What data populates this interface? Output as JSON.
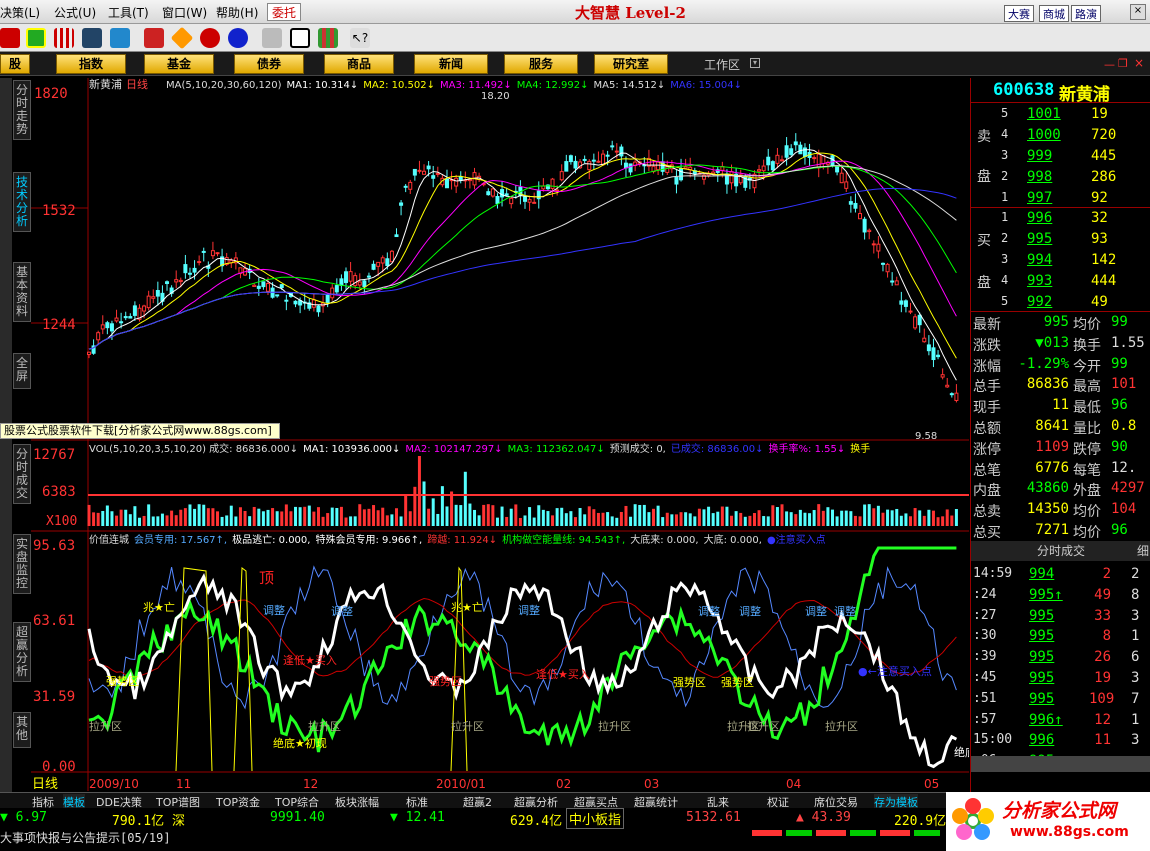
{
  "menubar": {
    "items": [
      "决策(L)",
      "公式(U)",
      "工具(T)",
      "窗口(W)",
      "帮助(H)"
    ],
    "commission": "委托",
    "logo": "大智慧 Level-2",
    "right_buttons": [
      "大赛",
      "商城",
      "路演"
    ]
  },
  "categories": [
    "股",
    "指数",
    "基金",
    "债券",
    "商品",
    "新闻",
    "服务",
    "研究室"
  ],
  "workzone": "工作区",
  "sidetabs": [
    "分时走势",
    "技术分析",
    "基本资料",
    "全屏",
    "分时成交",
    "实盘监控",
    "超赢分析",
    "其他"
  ],
  "main": {
    "title": "新黄浦",
    "period": "日线",
    "ma_legend": [
      {
        "t": "MA(5,10,20,30,60,120)",
        "c": "#ddd"
      },
      {
        "t": "MA1: 10.314↓",
        "c": "#fff"
      },
      {
        "t": "MA2: 10.502↓",
        "c": "#ff0"
      },
      {
        "t": "MA3: 11.492↓",
        "c": "#f0f"
      },
      {
        "t": "MA4: 12.992↓",
        "c": "#0f0"
      },
      {
        "t": "MA5: 14.512↓",
        "c": "#ddd"
      },
      {
        "t": "MA6: 15.004↓",
        "c": "#33f"
      }
    ],
    "y_labels": [
      "1820",
      "1532",
      "1244"
    ],
    "high_label": "18.20",
    "low_label": "9.58"
  },
  "volume": {
    "y_labels": [
      "12767",
      "6383",
      "X100"
    ],
    "legend": [
      {
        "t": "VOL(5,10,20,3,5,10,20) 成交: 86836.000↓",
        "c": "#ddd"
      },
      {
        "t": "MA1: 103936.000↓",
        "c": "#fff"
      },
      {
        "t": "MA2: 102147.297↓",
        "c": "#f0f"
      },
      {
        "t": "MA3: 112362.047↓",
        "c": "#0f0"
      },
      {
        "t": "预测成交: 0,",
        "c": "#ddd"
      },
      {
        "t": "已成交: 86836.00↓",
        "c": "#33f"
      },
      {
        "t": "换手率%: 1.55↓",
        "c": "#f0f"
      },
      {
        "t": "换手",
        "c": "#ff0"
      }
    ]
  },
  "indicator": {
    "y_labels": [
      "95.63",
      "63.61",
      "31.59",
      "0.00"
    ],
    "legend": [
      {
        "t": "价值连城",
        "c": "#ddd"
      },
      {
        "t": "会员专用: 17.567↑,",
        "c": "#5af"
      },
      {
        "t": "极品逃亡: 0.000,",
        "c": "#fff"
      },
      {
        "t": "特殊会员专用: 9.966↑,",
        "c": "#fff"
      },
      {
        "t": "蹄越: 11.924↓",
        "c": "#f33"
      },
      {
        "t": "机构做空能量线: 94.543↑,",
        "c": "#0f0"
      },
      {
        "t": "大底来: 0.000,",
        "c": "#ddd"
      },
      {
        "t": "大底: 0.000,",
        "c": "#ddd"
      },
      {
        "t": "●注意买入点",
        "c": "#33f"
      }
    ],
    "annotations": [
      {
        "t": "顶",
        "c": "#f22"
      },
      {
        "t": "兆★亡",
        "c": "#ff0"
      },
      {
        "t": "调整",
        "c": "#5af"
      },
      {
        "t": "调整",
        "c": "#5af"
      },
      {
        "t": "逢低★买入",
        "c": "#f22"
      },
      {
        "t": "强势区",
        "c": "#ff0"
      },
      {
        "t": "强势区",
        "c": "#f22"
      },
      {
        "t": "兆★亡",
        "c": "#ff0"
      },
      {
        "t": "调整",
        "c": "#5af"
      },
      {
        "t": "逢低★买入",
        "c": "#f22"
      },
      {
        "t": "强势区",
        "c": "#ff0"
      },
      {
        "t": "强势区",
        "c": "#ff0"
      },
      {
        "t": "调整",
        "c": "#5af"
      },
      {
        "t": "调整",
        "c": "#5af"
      },
      {
        "t": "调整",
        "c": "#5af"
      },
      {
        "t": "调整",
        "c": "#5af"
      },
      {
        "t": "●←注意买入点",
        "c": "#33f"
      },
      {
        "t": "绝底★初现",
        "c": "#ff0"
      },
      {
        "t": "拉升区",
        "c": "#aa8"
      },
      {
        "t": "拉升区",
        "c": "#aa8"
      },
      {
        "t": "拉升区",
        "c": "#aa8"
      },
      {
        "t": "拉升区",
        "c": "#aa8"
      },
      {
        "t": "拉升区",
        "c": "#aa8"
      },
      {
        "t": "拉升区",
        "c": "#aa8"
      },
      {
        "t": "拉升区",
        "c": "#aa8"
      },
      {
        "t": "绝底",
        "c": "#fff"
      }
    ]
  },
  "dates": [
    "日线",
    "2009/10",
    "11",
    "12",
    "2010/01",
    "02",
    "03",
    "04",
    "05"
  ],
  "ad_banner": "股票公式股票软件下载[分析家公式网www.88gs.com]",
  "quote": {
    "code": "600638",
    "name": "新黄浦",
    "sell": [
      [
        "5",
        "1001",
        "19"
      ],
      [
        "4",
        "1000",
        "720"
      ],
      [
        "3",
        "999",
        "445"
      ],
      [
        "2",
        "998",
        "286"
      ],
      [
        "1",
        "997",
        "92"
      ]
    ],
    "buy": [
      [
        "1",
        "996",
        "32"
      ],
      [
        "2",
        "995",
        "93"
      ],
      [
        "3",
        "994",
        "142"
      ],
      [
        "4",
        "993",
        "444"
      ],
      [
        "5",
        "992",
        "49"
      ]
    ],
    "sell_label": [
      "卖",
      "盘"
    ],
    "buy_label": [
      "买",
      "盘"
    ],
    "stats": [
      [
        "最新",
        "995",
        "均价",
        "99"
      ],
      [
        "涨跌",
        "▼013",
        "换手",
        "1.55"
      ],
      [
        "涨幅",
        "-1.29%",
        "今开",
        "99"
      ],
      [
        "总手",
        "86836",
        "最高",
        "101"
      ],
      [
        "现手",
        "11",
        "最低",
        "96"
      ],
      [
        "总额",
        "8641",
        "量比",
        "0.8"
      ],
      [
        "涨停",
        "1109",
        "跌停",
        "90"
      ],
      [
        "总笔",
        "6776",
        "每笔",
        "12."
      ],
      [
        "内盘",
        "43860",
        "外盘",
        "4297"
      ],
      [
        "总卖",
        "14350",
        "均价",
        "104"
      ],
      [
        "总买",
        "7271",
        "均价",
        "96"
      ]
    ],
    "ticks_title": "分时成交",
    "ticks_tab": "细",
    "ticks": [
      [
        "14:59",
        "994",
        "2",
        "2"
      ],
      [
        ":24",
        "995↑",
        "49",
        "8"
      ],
      [
        ":27",
        "995",
        "33",
        "3"
      ],
      [
        ":30",
        "995",
        "8",
        "1"
      ],
      [
        ":39",
        "995",
        "26",
        "6"
      ],
      [
        ":45",
        "995",
        "19",
        "3"
      ],
      [
        ":51",
        "995",
        "109",
        "7"
      ],
      [
        ":57",
        "996↑",
        "12",
        "1"
      ],
      [
        "15:00",
        "996",
        "11",
        "3"
      ],
      [
        ":06",
        "995↓",
        "",
        ""
      ]
    ]
  },
  "bottom_tabs": [
    "指标",
    "模板",
    "DDE决策",
    "TOP谱图",
    "TOP资金",
    "TOP综合",
    "板块涨幅",
    "标准",
    "超赢2",
    "超赢分析",
    "超赢买点",
    "超赢统计",
    "乱来",
    "权证",
    "席位交易",
    "存为模板"
  ],
  "status": {
    "v1": "▼ 6.97",
    "v2": "790.1亿 深",
    "v3": "9991.40",
    "v4": "▼ 12.41",
    "v5": "629.4亿",
    "v6": "中小板指",
    "v7": "5132.61",
    "v8": "▲ 43.39",
    "v9": "220.9亿",
    "notice": "大事项快报与公告提示[05/19]"
  },
  "watermark": {
    "brand": "分析家公式网",
    "url": "www.88gs.com"
  }
}
